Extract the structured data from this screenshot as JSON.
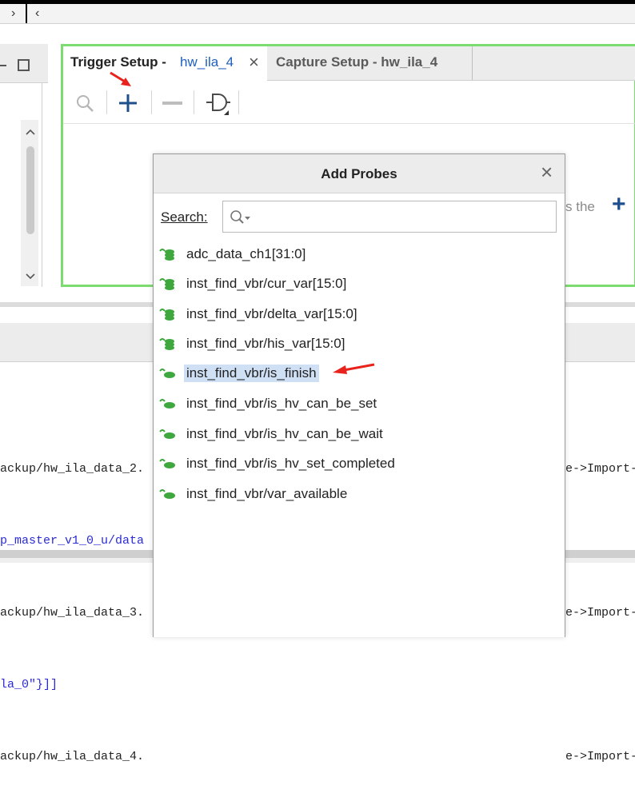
{
  "nav": {
    "forward_glyph": "›",
    "back_glyph": "‹"
  },
  "left_pane": {
    "maximize_glyph": "□",
    "scroll_up_glyph": "⌃",
    "scroll_down_glyph": "⌄"
  },
  "tabs": [
    {
      "label": "Trigger Setup - ",
      "target": "hw_ila_4",
      "close_glyph": "×",
      "active": true
    },
    {
      "label": "Capture Setup - hw_ila_4",
      "active": false
    }
  ],
  "toolbar": {
    "hint_text": "s the",
    "hint_plus": "+"
  },
  "console": {
    "lines_left": [
      {
        "text": "ackup/hw_ila_data_2.",
        "color": "#222222"
      },
      {
        "text": "p_master_v1_0_u/data",
        "color": "#2b2bd6"
      },
      {
        "text": "ackup/hw_ila_data_3.",
        "color": "#222222"
      },
      {
        "text": "la_0\"}]]",
        "color": "#2b2bd6"
      },
      {
        "text": "ackup/hw_ila_data_4.",
        "color": "#222222"
      }
    ],
    "lines_right": [
      "e->Import-",
      "e->Import-",
      "e->Import-"
    ]
  },
  "dialog": {
    "title": "Add Probes",
    "close_glyph": "×",
    "search_label": "Search:",
    "search_value": "",
    "probes": [
      {
        "label": "adc_data_ch1[31:0]",
        "kind": "bus"
      },
      {
        "label": "inst_find_vbr/cur_var[15:0]",
        "kind": "bus"
      },
      {
        "label": "inst_find_vbr/delta_var[15:0]",
        "kind": "bus"
      },
      {
        "label": "inst_find_vbr/his_var[15:0]",
        "kind": "bus"
      },
      {
        "label": "inst_find_vbr/is_finish",
        "kind": "bit",
        "selected": true
      },
      {
        "label": "inst_find_vbr/is_hv_can_be_set",
        "kind": "bit"
      },
      {
        "label": "inst_find_vbr/is_hv_can_be_wait",
        "kind": "bit"
      },
      {
        "label": "inst_find_vbr/is_hv_set_completed",
        "kind": "bit"
      },
      {
        "label": "inst_find_vbr/var_available",
        "kind": "bit"
      }
    ]
  },
  "colors": {
    "panel_border": "#7ddc6f",
    "accent_blue": "#1f5fbf",
    "probe_green": "#3ea83e",
    "selection": "#cfe0f5",
    "annotation_red": "#e8231d"
  },
  "icons": [
    "forward-chevron-icon",
    "back-chevron-icon",
    "maximize-icon",
    "search-icon",
    "add-icon",
    "remove-icon",
    "trigger-gate-icon",
    "close-icon",
    "bus-probe-icon",
    "bit-probe-icon",
    "red-arrow-annotation"
  ]
}
